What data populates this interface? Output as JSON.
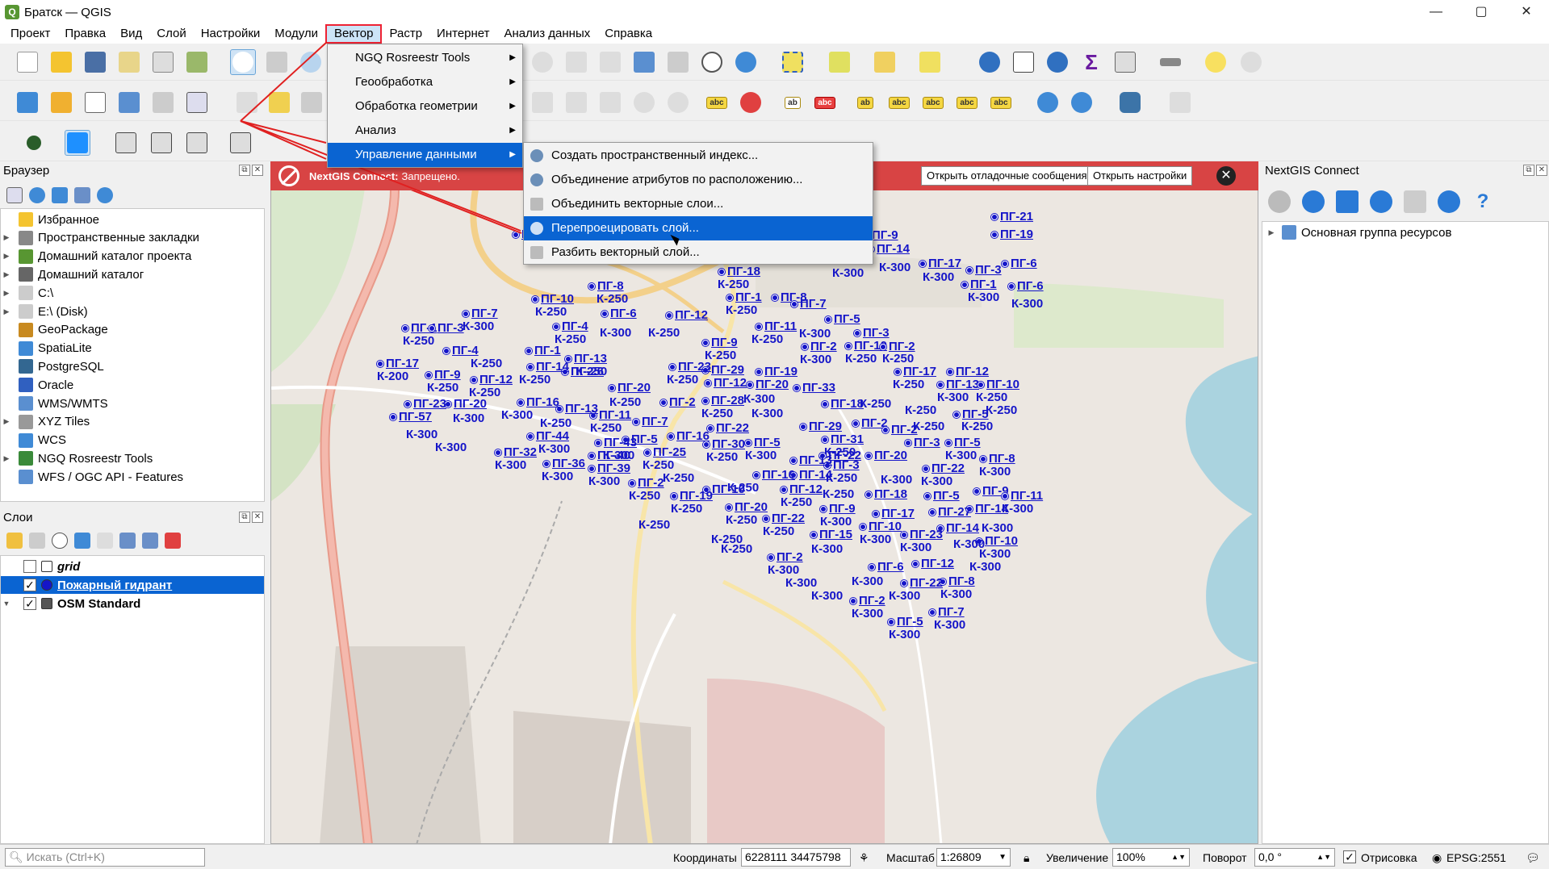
{
  "window": {
    "title": "Братск — QGIS",
    "app_icon": "qgis-icon",
    "controls": [
      "—",
      "▢",
      "✕"
    ]
  },
  "menubar": [
    "Проект",
    "Правка",
    "Вид",
    "Слой",
    "Настройки",
    "Модули",
    "Вектор",
    "Растр",
    "Интернет",
    "Анализ данных",
    "Справка"
  ],
  "vector_menu": {
    "items": [
      {
        "label": "NGQ Rosreestr Tools",
        "submenu": true
      },
      {
        "label": "Геообработка",
        "submenu": true
      },
      {
        "label": "Обработка геометрии",
        "submenu": true
      },
      {
        "label": "Анализ",
        "submenu": true
      },
      {
        "label": "Управление данными",
        "submenu": true
      }
    ]
  },
  "data_management_menu": {
    "items": [
      "Создать пространственный индекс...",
      "Объединение атрибутов по расположению...",
      "Объединить векторные слои...",
      "Перепроецировать слой...",
      "Разбить векторный слой..."
    ]
  },
  "browser": {
    "title": "Браузер",
    "items": [
      {
        "label": "Избранное",
        "icon": "star-icon",
        "expandable": false
      },
      {
        "label": "Пространственные закладки",
        "icon": "bookmarks-icon",
        "expandable": true
      },
      {
        "label": "Домашний каталог проекта",
        "icon": "project-home-icon",
        "expandable": true
      },
      {
        "label": "Домашний каталог",
        "icon": "home-icon",
        "expandable": true
      },
      {
        "label": "C:\\",
        "icon": "drive-icon",
        "expandable": true
      },
      {
        "label": "E:\\ (Disk)",
        "icon": "drive-icon",
        "expandable": true
      },
      {
        "label": "GeoPackage",
        "icon": "geopackage-icon",
        "expandable": false
      },
      {
        "label": "SpatiaLite",
        "icon": "spatialite-icon",
        "expandable": false
      },
      {
        "label": "PostgreSQL",
        "icon": "postgresql-icon",
        "expandable": false
      },
      {
        "label": "Oracle",
        "icon": "oracle-icon",
        "expandable": false
      },
      {
        "label": "WMS/WMTS",
        "icon": "wms-icon",
        "expandable": false
      },
      {
        "label": "XYZ Tiles",
        "icon": "xyz-icon",
        "expandable": true
      },
      {
        "label": "WCS",
        "icon": "wcs-icon",
        "expandable": false
      },
      {
        "label": "NGQ Rosreestr Tools",
        "icon": "rosreestr-icon",
        "expandable": true
      },
      {
        "label": "WFS / OGC API - Features",
        "icon": "wfs-icon",
        "expandable": false
      }
    ]
  },
  "layers": {
    "title": "Слои",
    "items": [
      {
        "label": "grid",
        "checked": false,
        "italic": true,
        "selected": false,
        "icon": "polygon-icon"
      },
      {
        "label": "Пожарный гидрант",
        "checked": true,
        "italic": false,
        "selected": true,
        "icon": "point-icon"
      },
      {
        "label": "OSM Standard",
        "checked": true,
        "italic": false,
        "selected": false,
        "icon": "tiles-icon"
      }
    ]
  },
  "messagebar": {
    "title": "NextGIS Connect:",
    "text": "Запрещено.",
    "btn_debug": "Открыть отладочные сообщения",
    "btn_settings": "Открыть настройки",
    "close": "✕"
  },
  "nextgis": {
    "title": "NextGIS Connect",
    "root": "Основная группа ресурсов"
  },
  "hydrants": [
    [
      "ПГ-21",
      "1227",
      "260"
    ],
    [
      "ПГ-19",
      "1227",
      "282"
    ],
    [
      "ПГ-6",
      "1240",
      "318"
    ],
    [
      "ПГ-6",
      "1248",
      "346"
    ],
    [
      "К-300",
      "1252",
      "368"
    ],
    [
      "ПГ-17",
      "1138",
      "318"
    ],
    [
      "К-300",
      "1142",
      "335"
    ],
    [
      "ПГ-3",
      "1196",
      "326"
    ],
    [
      "ПГ-1",
      "1190",
      "344"
    ],
    [
      "К-300",
      "1198",
      "360"
    ],
    [
      "ПГ-9",
      "1068",
      "283"
    ],
    [
      "ПГ-14",
      "1074",
      "300"
    ],
    [
      "К-300",
      "1088",
      "323"
    ],
    [
      "ПГ-7",
      "1022",
      "299"
    ],
    [
      "К-300",
      "1030",
      "330"
    ],
    [
      "ПГ-4",
      "1002",
      "283"
    ],
    [
      "ПГ-6",
      "982",
      "313"
    ],
    [
      "ПГ-1",
      "942",
      "278"
    ],
    [
      "К-250",
      "942",
      "295"
    ],
    [
      "ПГ-31",
      "813",
      "274"
    ],
    [
      "К-250",
      "855",
      "274"
    ],
    [
      "ПГ-2",
      "798",
      "296"
    ],
    [
      "К-250",
      "798",
      "312"
    ],
    [
      "ПГ-4",
      "834",
      "296"
    ],
    [
      "К-250",
      "848",
      "312"
    ],
    [
      "ПГ-9",
      "913",
      "296"
    ],
    [
      "К-300",
      "912",
      "312"
    ],
    [
      "ПГ-18",
      "889",
      "328"
    ],
    [
      "К-250",
      "888",
      "344"
    ],
    [
      "ПГ-1",
      "899",
      "360"
    ],
    [
      "К-250",
      "898",
      "376"
    ],
    [
      "ПГ-8",
      "955",
      "360"
    ],
    [
      "ПГ-7",
      "979",
      "368"
    ],
    [
      "ПГ-5",
      "1021",
      "387"
    ],
    [
      "К-300",
      "989",
      "405"
    ],
    [
      "ПГ-3",
      "1057",
      "404"
    ],
    [
      "ПГ-10",
      "1046",
      "420"
    ],
    [
      "К-250",
      "1046",
      "436"
    ],
    [
      "ПГ-2",
      "1089",
      "421"
    ],
    [
      "К-250",
      "1092",
      "436"
    ],
    [
      "ПГ-2",
      "992",
      "421"
    ],
    [
      "К-300",
      "990",
      "437"
    ],
    [
      "ПГ-11",
      "935",
      "396"
    ],
    [
      "К-250",
      "930",
      "412"
    ],
    [
      "ПГ-9",
      "869",
      "416"
    ],
    [
      "К-250",
      "872",
      "432"
    ],
    [
      "ПГ-29",
      "869",
      "450"
    ],
    [
      "ПГ-19",
      "935",
      "452"
    ],
    [
      "ПГ-23",
      "828",
      "446"
    ],
    [
      "К-250",
      "825",
      "462"
    ],
    [
      "ПГ-12",
      "872",
      "466"
    ],
    [
      "ПГ-20",
      "924",
      "468"
    ],
    [
      "ПГ-33",
      "982",
      "472"
    ],
    [
      "ПГ-28",
      "869",
      "488"
    ],
    [
      "К-250",
      "868",
      "504"
    ],
    [
      "К-300",
      "920",
      "486"
    ],
    [
      "ПГ-18",
      "1017",
      "492"
    ],
    [
      "К-250",
      "1064",
      "492"
    ],
    [
      "ПГ-17",
      "1107",
      "452"
    ],
    [
      "К-250",
      "1105",
      "468"
    ],
    [
      "ПГ-12",
      "1172",
      "452"
    ],
    [
      "ПГ-13",
      "1160",
      "468"
    ],
    [
      "К-300",
      "1160",
      "484"
    ],
    [
      "ПГ-10",
      "1210",
      "468"
    ],
    [
      "К-250",
      "1208",
      "484"
    ],
    [
      "К-250",
      "1220",
      "500"
    ],
    [
      "К-250",
      "1120",
      "500"
    ],
    [
      "ПГ-5",
      "1180",
      "505"
    ],
    [
      "К-250",
      "1130",
      "520"
    ],
    [
      "К-250",
      "1190",
      "520"
    ],
    [
      "ПГ-12",
      "824",
      "382"
    ],
    [
      "К-250",
      "802",
      "404"
    ],
    [
      "ПГ-6",
      "744",
      "380"
    ],
    [
      "К-300",
      "742",
      "404"
    ],
    [
      "ПГ-4",
      "684",
      "396"
    ],
    [
      "К-250",
      "686",
      "412"
    ],
    [
      "ПГ-13",
      "699",
      "436"
    ],
    [
      "К-250",
      "712",
      "452"
    ],
    [
      "ПГ-26",
      "695",
      "452"
    ],
    [
      "ПГ-20",
      "753",
      "472"
    ],
    [
      "К-250",
      "754",
      "490"
    ],
    [
      "ПГ-2",
      "817",
      "490"
    ],
    [
      "ПГ-11",
      "730",
      "506"
    ],
    [
      "К-250",
      "730",
      "522"
    ],
    [
      "ПГ-7",
      "783",
      "514"
    ],
    [
      "ПГ-5",
      "770",
      "536"
    ],
    [
      "ПГ-16",
      "826",
      "532"
    ],
    [
      "ПГ-22",
      "875",
      "522"
    ],
    [
      "К-300",
      "930",
      "504"
    ],
    [
      "ПГ-29",
      "990",
      "520"
    ],
    [
      "ПГ-2",
      "1055",
      "516"
    ],
    [
      "ПГ-2",
      "1092",
      "524"
    ],
    [
      "ПГ-31",
      "1017",
      "536"
    ],
    [
      "К-250",
      "1020",
      "552"
    ],
    [
      "ПГ-20",
      "1071",
      "556"
    ],
    [
      "ПГ-3",
      "1120",
      "540"
    ],
    [
      "ПГ-5",
      "1170",
      "540"
    ],
    [
      "К-300",
      "1170",
      "556"
    ],
    [
      "ПГ-8",
      "1213",
      "560"
    ],
    [
      "К-300",
      "1212",
      "576"
    ],
    [
      "ПГ-22",
      "1142",
      "572"
    ],
    [
      "К-300",
      "1140",
      "588"
    ],
    [
      "ПГ-9",
      "1205",
      "600"
    ],
    [
      "ПГ-11",
      "1240",
      "606"
    ],
    [
      "К-300",
      "1240",
      "622"
    ],
    [
      "ПГ-5",
      "1144",
      "606"
    ],
    [
      "ПГ-14",
      "1196",
      "622"
    ],
    [
      "ПГ-27",
      "1150",
      "626"
    ],
    [
      "ПГ-14",
      "1160",
      "646"
    ],
    [
      "К-300",
      "1215",
      "646"
    ],
    [
      "ПГ-10",
      "1208",
      "662"
    ],
    [
      "К-300",
      "1212",
      "678"
    ],
    [
      "К-300",
      "1200",
      "694"
    ],
    [
      "ПГ-23",
      "1115",
      "654"
    ],
    [
      "К-300",
      "1114",
      "670"
    ],
    [
      "К-300",
      "1180",
      "666"
    ],
    [
      "ПГ-12",
      "1129",
      "690"
    ],
    [
      "ПГ-8",
      "1163",
      "712"
    ],
    [
      "К-300",
      "1164",
      "728"
    ],
    [
      "ПГ-22",
      "1115",
      "714"
    ],
    [
      "К-300",
      "1100",
      "730"
    ],
    [
      "ПГ-7",
      "1150",
      "750"
    ],
    [
      "К-300",
      "1156",
      "766"
    ],
    [
      "ПГ-5",
      "1099",
      "762"
    ],
    [
      "К-300",
      "1100",
      "778"
    ],
    [
      "ПГ-6",
      "1075",
      "694"
    ],
    [
      "К-300",
      "1054",
      "712"
    ],
    [
      "ПГ-2",
      "1052",
      "736"
    ],
    [
      "К-300",
      "1054",
      "752"
    ],
    [
      "К-300",
      "1004",
      "730"
    ],
    [
      "ПГ-10",
      "1064",
      "644"
    ],
    [
      "К-300",
      "1064",
      "660"
    ],
    [
      "ПГ-17",
      "1080",
      "628"
    ],
    [
      "ПГ-18",
      "1071",
      "604"
    ],
    [
      "К-300",
      "1090",
      "586"
    ],
    [
      "ПГ-22",
      "1014",
      "556"
    ],
    [
      "ПГ-3",
      "1020",
      "568"
    ],
    [
      "К-250",
      "1022",
      "584"
    ],
    [
      "К-250",
      "1018",
      "604"
    ],
    [
      "ПГ-9",
      "1015",
      "622"
    ],
    [
      "К-300",
      "1015",
      "638"
    ],
    [
      "ПГ-15",
      "1003",
      "654"
    ],
    [
      "К-300",
      "1004",
      "672"
    ],
    [
      "ПГ-22",
      "944",
      "634"
    ],
    [
      "К-250",
      "944",
      "650"
    ],
    [
      "ПГ-12",
      "966",
      "598"
    ],
    [
      "К-250",
      "966",
      "614"
    ],
    [
      "ПГ-14",
      "978",
      "580"
    ],
    [
      "ПГ-13",
      "978",
      "562"
    ],
    [
      "ПГ-16",
      "932",
      "580"
    ],
    [
      "К-250",
      "900",
      "596"
    ],
    [
      "ПГ-20",
      "898",
      "620"
    ],
    [
      "К-250",
      "898",
      "636"
    ],
    [
      "К-250",
      "880",
      "660"
    ],
    [
      "ПГ-2",
      "950",
      "682"
    ],
    [
      "К-300",
      "950",
      "698"
    ],
    [
      "К-300",
      "972",
      "714"
    ],
    [
      "ПГ-30",
      "870",
      "542"
    ],
    [
      "К-250",
      "874",
      "558"
    ],
    [
      "ПГ-5",
      "922",
      "540"
    ],
    [
      "К-300",
      "922",
      "556"
    ],
    [
      "ПГ-10",
      "870",
      "598"
    ],
    [
      "К-250",
      "892",
      "672"
    ],
    [
      "ПГ-19",
      "830",
      "606"
    ],
    [
      "К-250",
      "830",
      "622"
    ],
    [
      "ПГ-2",
      "778",
      "590"
    ],
    [
      "К-250",
      "778",
      "606"
    ],
    [
      "К-250",
      "790",
      "642"
    ],
    [
      "К-250",
      "820",
      "584"
    ],
    [
      "ПГ-25",
      "797",
      "552"
    ],
    [
      "К-250",
      "795",
      "568"
    ],
    [
      "ПГ-43",
      "736",
      "540"
    ],
    [
      "К-300",
      "746",
      "556"
    ],
    [
      "ПГ-40",
      "728",
      "556"
    ],
    [
      "ПГ-39",
      "728",
      "572"
    ],
    [
      "К-300",
      "728",
      "588"
    ],
    [
      "ПГ-36",
      "672",
      "566"
    ],
    [
      "К-300",
      "670",
      "582"
    ],
    [
      "ПГ-44",
      "652",
      "532"
    ],
    [
      "К-300",
      "666",
      "548"
    ],
    [
      "ПГ-32",
      "612",
      "552"
    ],
    [
      "К-300",
      "612",
      "568"
    ],
    [
      "ПГ-13",
      "688",
      "498"
    ],
    [
      "К-250",
      "668",
      "516"
    ],
    [
      "ПГ-16",
      "640",
      "490"
    ],
    [
      "К-300",
      "620",
      "506"
    ],
    [
      "ПГ-12",
      "582",
      "462"
    ],
    [
      "К-250",
      "580",
      "478"
    ],
    [
      "ПГ-20",
      "550",
      "492"
    ],
    [
      "К-300",
      "560",
      "510"
    ],
    [
      "ПГ-14",
      "652",
      "446"
    ],
    [
      "К-250",
      "642",
      "462"
    ],
    [
      "ПГ-1",
      "650",
      "426"
    ],
    [
      "К-250",
      "582",
      "442"
    ],
    [
      "ПГ-4",
      "548",
      "426"
    ],
    [
      "ПГ-1",
      "497",
      "398"
    ],
    [
      "К-250",
      "498",
      "414"
    ],
    [
      "ПГ-3",
      "530",
      "398"
    ],
    [
      "ПГ-7",
      "572",
      "380"
    ],
    [
      "К-300",
      "572",
      "396"
    ],
    [
      "ПГ-17",
      "466",
      "442"
    ],
    [
      "К-200",
      "466",
      "458"
    ],
    [
      "ПГ-9",
      "526",
      "456"
    ],
    [
      "К-250",
      "528",
      "472"
    ],
    [
      "ПГ-23",
      "500",
      "492"
    ],
    [
      "ПГ-57",
      "482",
      "508"
    ],
    [
      "К-300",
      "502",
      "530"
    ],
    [
      "К-300",
      "538",
      "546"
    ],
    [
      "ПГ-10",
      "658",
      "362"
    ],
    [
      "К-250",
      "662",
      "378"
    ],
    [
      "ПГ-8",
      "728",
      "346"
    ],
    [
      "К-250",
      "738",
      "362"
    ],
    [
      "ПГ-5",
      "634",
      "282"
    ],
    [
      "К-300",
      "654",
      "298"
    ],
    [
      "ПГ-1",
      "760",
      "296"
    ],
    [
      "К-300",
      "738",
      "312"
    ],
    [
      "ПГ-2",
      "800",
      "296"
    ],
    [
      "К-250",
      "700",
      "314"
    ],
    [
      "ПГ-13",
      "690",
      "270"
    ],
    [
      "К-300",
      "746",
      "270"
    ],
    [
      "К-300",
      "700",
      "288"
    ],
    [
      "К-250",
      "682",
      "314"
    ]
  ],
  "statusbar": {
    "search_placeholder": "Искать (Ctrl+K)",
    "coord_label": "Координаты",
    "coord_value": "6228111  34475798",
    "scale_label": "Масштаб",
    "scale_value": "1:26809",
    "magnifier_label": "Увеличение",
    "magnifier_value": "100%",
    "rotation_label": "Поворот",
    "rotation_value": "0,0 °",
    "render_label": "Отрисовка",
    "render_checked": true,
    "crs": "EPSG:2551"
  },
  "colors": {
    "accent": "#0a64d2",
    "hydrant": "#1515c8",
    "msgbar": "#d84444",
    "annotation_red": "#e02020"
  }
}
